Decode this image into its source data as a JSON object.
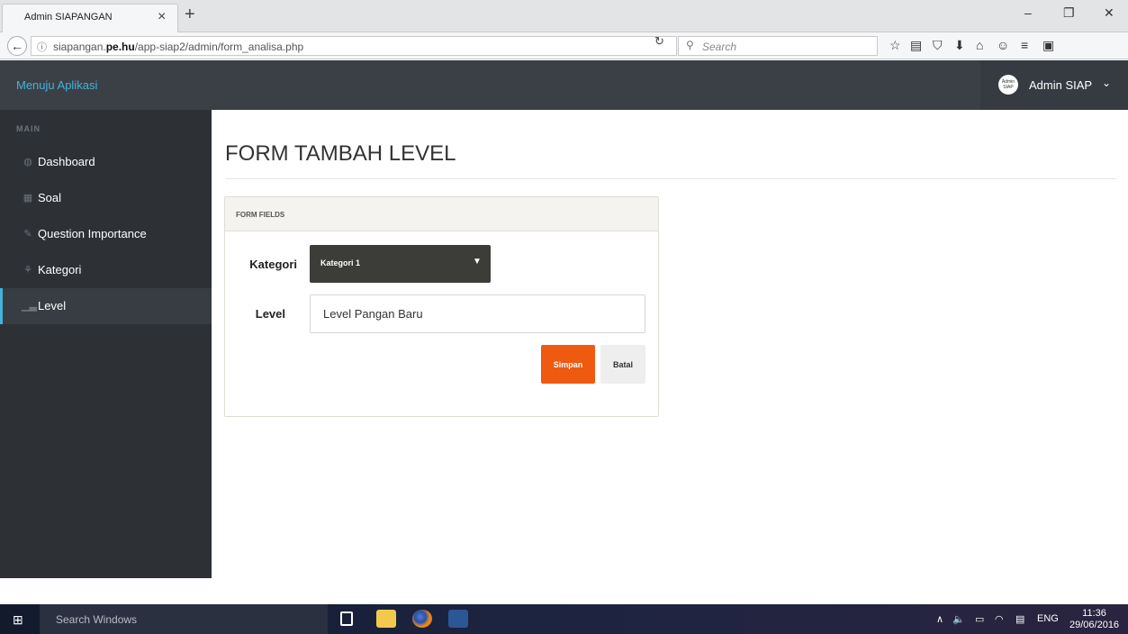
{
  "browser": {
    "tab_title": "Admin SIAPANGAN",
    "tab_close": "×",
    "new_tab": "+",
    "url_prefix": "siapangan.",
    "url_domain": "pe.hu",
    "url_path": "/app-siap2/admin/form_analisa.php",
    "search_placeholder": "Search",
    "window_controls": {
      "minimize": "–",
      "restore": "❐",
      "close": "✕"
    }
  },
  "header": {
    "brand": "Menuju Aplikasi",
    "avatar_text": "Admin SIAP",
    "user_name": "Admin SIAP",
    "chevron": "⌄"
  },
  "sidebar": {
    "section": "MAIN",
    "items": [
      {
        "icon": "dashboard-icon",
        "glyph": "◍",
        "label": "Dashboard"
      },
      {
        "icon": "table-icon",
        "glyph": "▦",
        "label": "Soal"
      },
      {
        "icon": "edit-icon",
        "glyph": "✎",
        "label": "Question Importance"
      },
      {
        "icon": "sitemap-icon",
        "glyph": "⚘",
        "label": "Kategori"
      },
      {
        "icon": "signal-icon",
        "glyph": "▁▃",
        "label": "Level",
        "active": true
      }
    ]
  },
  "main": {
    "title": "FORM TAMBAH LEVEL",
    "panel_heading": "FORM FIELDS",
    "kategori_label": "Kategori",
    "kategori_value": "Kategori 1",
    "level_label": "Level",
    "level_value": "Level Pangan Baru",
    "save_button": "Simpan",
    "cancel_button": "Batal"
  },
  "taskbar": {
    "search_text": "Search Windows",
    "lang": "ENG",
    "time": "11:36",
    "date": "29/06/2016"
  },
  "colors": {
    "accent": "#45b3d8",
    "header_bg": "#3b4047",
    "sidebar_bg": "#2d3136",
    "save_button": "#ee5a10",
    "select_bg": "#3c3c38"
  }
}
